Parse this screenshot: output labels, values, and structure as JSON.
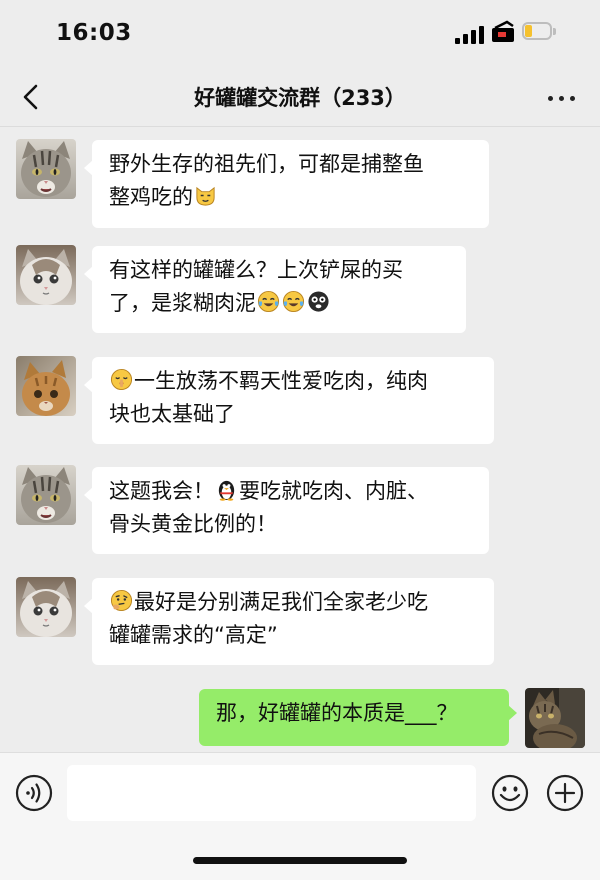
{
  "status_bar": {
    "time": "16:03"
  },
  "header": {
    "title": "好罐罐交流群（233）"
  },
  "messages": [
    {
      "lines": [
        "野外生存的祖先们，可都是捕整鱼",
        "整鸡吃的"
      ]
    },
    {
      "lines": [
        "有这样的罐罐么？上次铲屎的买",
        "了，是浆糊肉泥"
      ]
    },
    {
      "lines": [
        "一生放荡不羁天性爱吃肉，纯肉",
        "块也太基础了"
      ]
    },
    {
      "lines": [
        " 这题我会！",
        "要吃就吃肉、内脏、",
        "骨头黄金比例的！"
      ]
    },
    {
      "lines": [
        "最好是分别满足我们全家老少吃",
        "罐罐需求的“高定”"
      ]
    },
    {
      "lines": [
        "那，好罐罐的本质是___？"
      ]
    }
  ],
  "input": {
    "placeholder": ""
  },
  "icons": {
    "back": "chevron-left-icon",
    "more": "more-dots-icon",
    "voice": "voice-icon",
    "emoji": "smiley-icon",
    "plus": "plus-icon"
  },
  "colors": {
    "background": "#ededed",
    "own_bubble": "#95ec69",
    "other_bubble": "#ffffff"
  }
}
